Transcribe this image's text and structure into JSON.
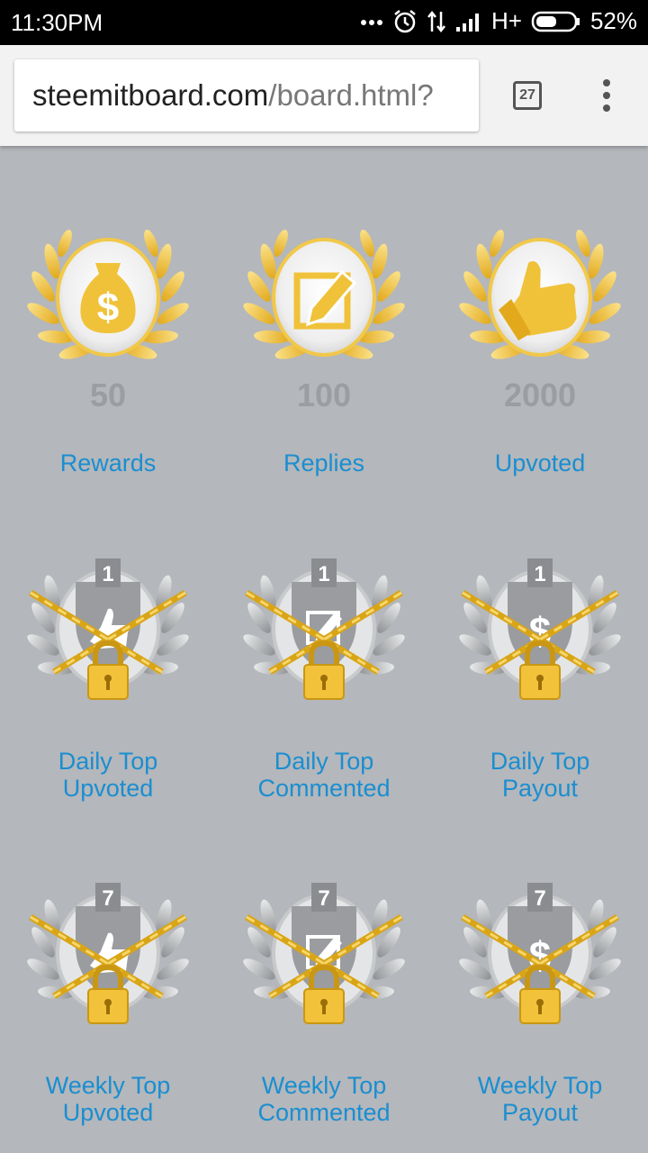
{
  "status_bar": {
    "time": "11:30PM",
    "network": "H+",
    "battery": "52%",
    "icons": [
      "more-dots-icon",
      "alarm-icon",
      "data-transfer-icon",
      "signal-icon",
      "battery-icon"
    ]
  },
  "browser": {
    "url_domain": "steemitboard.com",
    "url_path": "/board.html?",
    "tab_count": "27"
  },
  "badges": {
    "rewards": {
      "count": "50",
      "label": "Rewards",
      "icon": "dollar-bag-icon"
    },
    "replies": {
      "count": "100",
      "label": "Replies",
      "icon": "pencil-edit-icon"
    },
    "upvoted": {
      "count": "2000",
      "label": "Upvoted",
      "icon": "thumbs-up-icon"
    },
    "daily_upvoted": {
      "rank": "1",
      "label1": "Daily Top",
      "label2": "Upvoted"
    },
    "daily_commented": {
      "rank": "1",
      "label1": "Daily Top",
      "label2": "Commented"
    },
    "daily_payout": {
      "rank": "1",
      "label1": "Daily Top",
      "label2": "Payout"
    },
    "weekly_upvoted": {
      "rank": "7",
      "label1": "Weekly Top",
      "label2": "Upvoted"
    },
    "weekly_commented": {
      "rank": "7",
      "label1": "Weekly Top",
      "label2": "Commented"
    },
    "weekly_payout": {
      "rank": "7",
      "label1": "Weekly Top",
      "label2": "Payout"
    }
  },
  "colors": {
    "background": "#b4b7bb",
    "link": "#1a8ed1",
    "gold": "#f0c23a",
    "silver": "#a9abae"
  }
}
